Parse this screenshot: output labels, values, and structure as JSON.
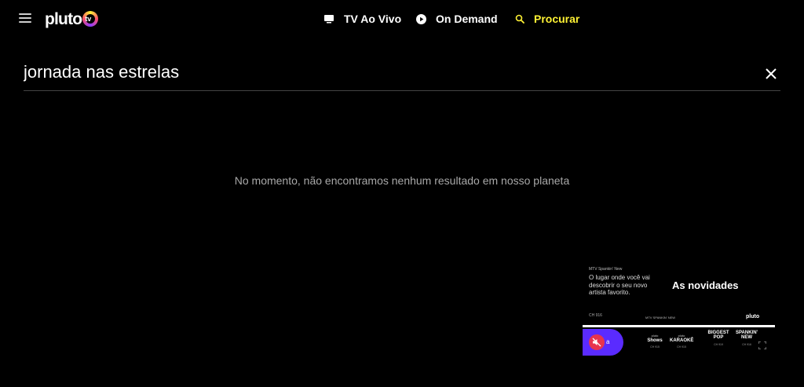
{
  "nav": {
    "logo_text": "pluto",
    "logo_badge": "tv",
    "items": [
      {
        "label": "TV Ao Vivo",
        "icon": "tv-icon",
        "active": false
      },
      {
        "label": "On Demand",
        "icon": "play-circle-icon",
        "active": false
      },
      {
        "label": "Procurar",
        "icon": "search-icon",
        "active": true
      }
    ]
  },
  "search": {
    "value": "jornada nas estrelas",
    "placeholder": "Procurar"
  },
  "results": {
    "empty_message": "No momento, não encontramos nenhum resultado em nosso planeta"
  },
  "mini_player": {
    "channel_name": "MTV Spankin' New",
    "tagline": "O lugar onde você vai descobrir o seu novo artista favorito.",
    "channel_number": "CH 916",
    "headline": "As novidades",
    "source": "MTV SPANKIN' NEW",
    "brand": "pluto",
    "mute_suffix": "a",
    "channels": [
      {
        "name": "Shows",
        "prefix": "pluto",
        "number": "CH 915"
      },
      {
        "name": "KARAOKÊ",
        "prefix": "pluto",
        "number": "CH 915"
      },
      {
        "name": "BIGGEST POP",
        "prefix": "",
        "number": "CH 919"
      },
      {
        "name": "SPANKIN' NEW",
        "prefix": "",
        "number": "CH 916"
      }
    ]
  },
  "colors": {
    "accent": "#fff234",
    "background": "#000000",
    "muted_text": "#a8a8a8",
    "player_purple": "#5a2bff",
    "mute_red": "#e8344e"
  }
}
